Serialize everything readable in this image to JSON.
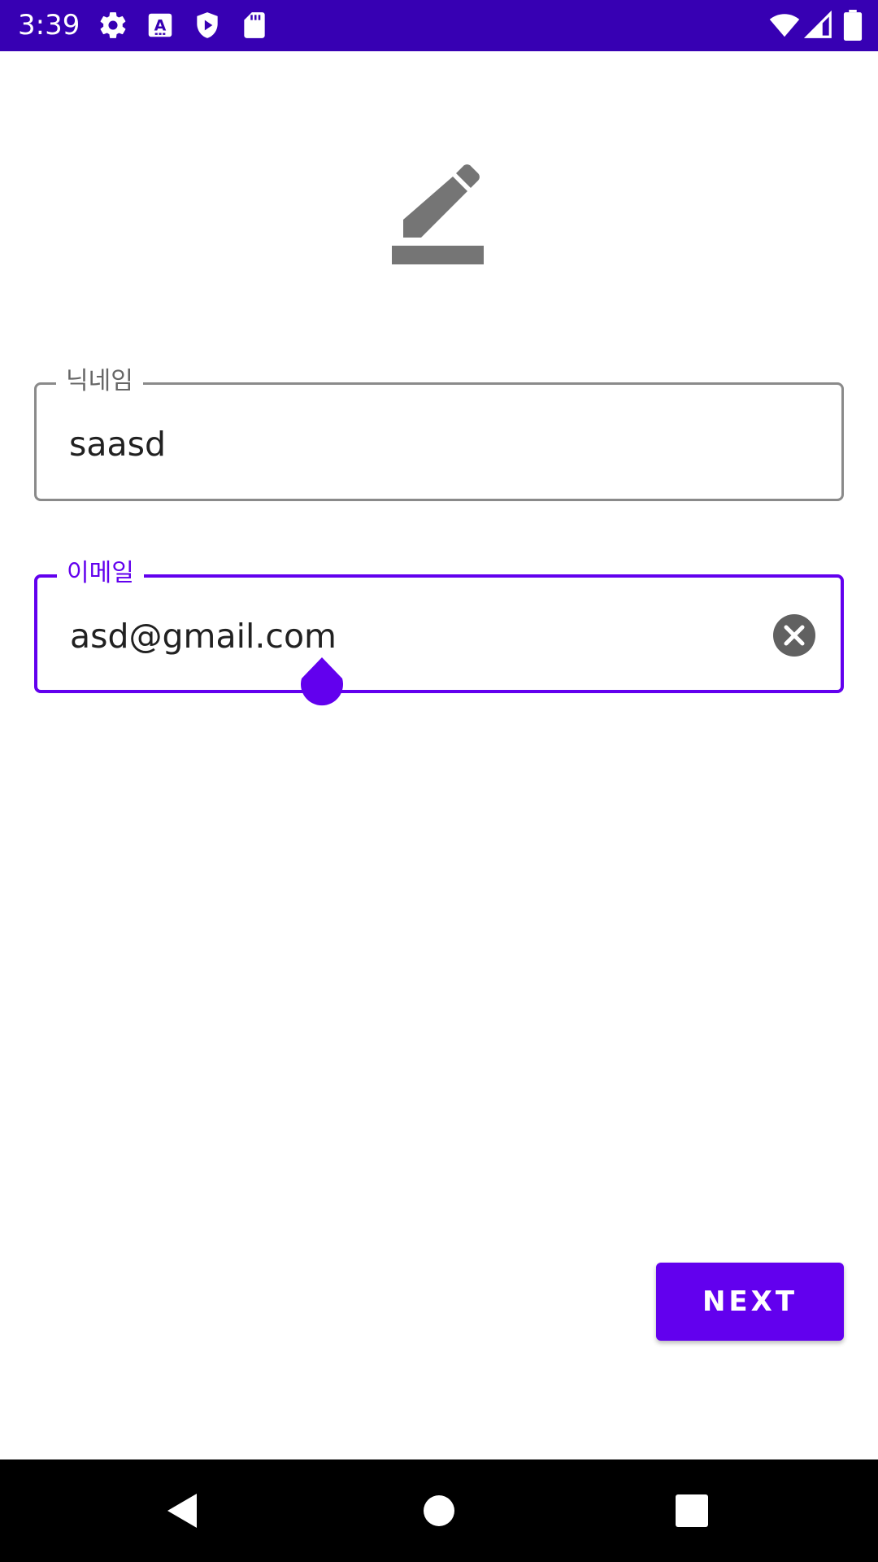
{
  "status_bar": {
    "time": "3:39",
    "left_icons": [
      "gear-icon",
      "a-icon",
      "shield-play-icon",
      "sd-card-icon"
    ],
    "right_icons": [
      "wifi-icon",
      "cell-signal-icon",
      "battery-icon"
    ],
    "background": "#3700b3"
  },
  "header": {
    "icon": "edit-icon",
    "icon_color": "#757575"
  },
  "form": {
    "nickname": {
      "label": "닉네임",
      "value": "saasd"
    },
    "email": {
      "label": "이메일",
      "value": "asd@gmail.com",
      "clear_icon": "clear-icon"
    }
  },
  "actions": {
    "next_label": "NEXT"
  },
  "colors": {
    "accent": "#6200ee",
    "border_inactive": "#8a8a8a"
  },
  "nav_bar": {
    "buttons": [
      "back-icon",
      "home-icon",
      "recents-icon"
    ]
  }
}
